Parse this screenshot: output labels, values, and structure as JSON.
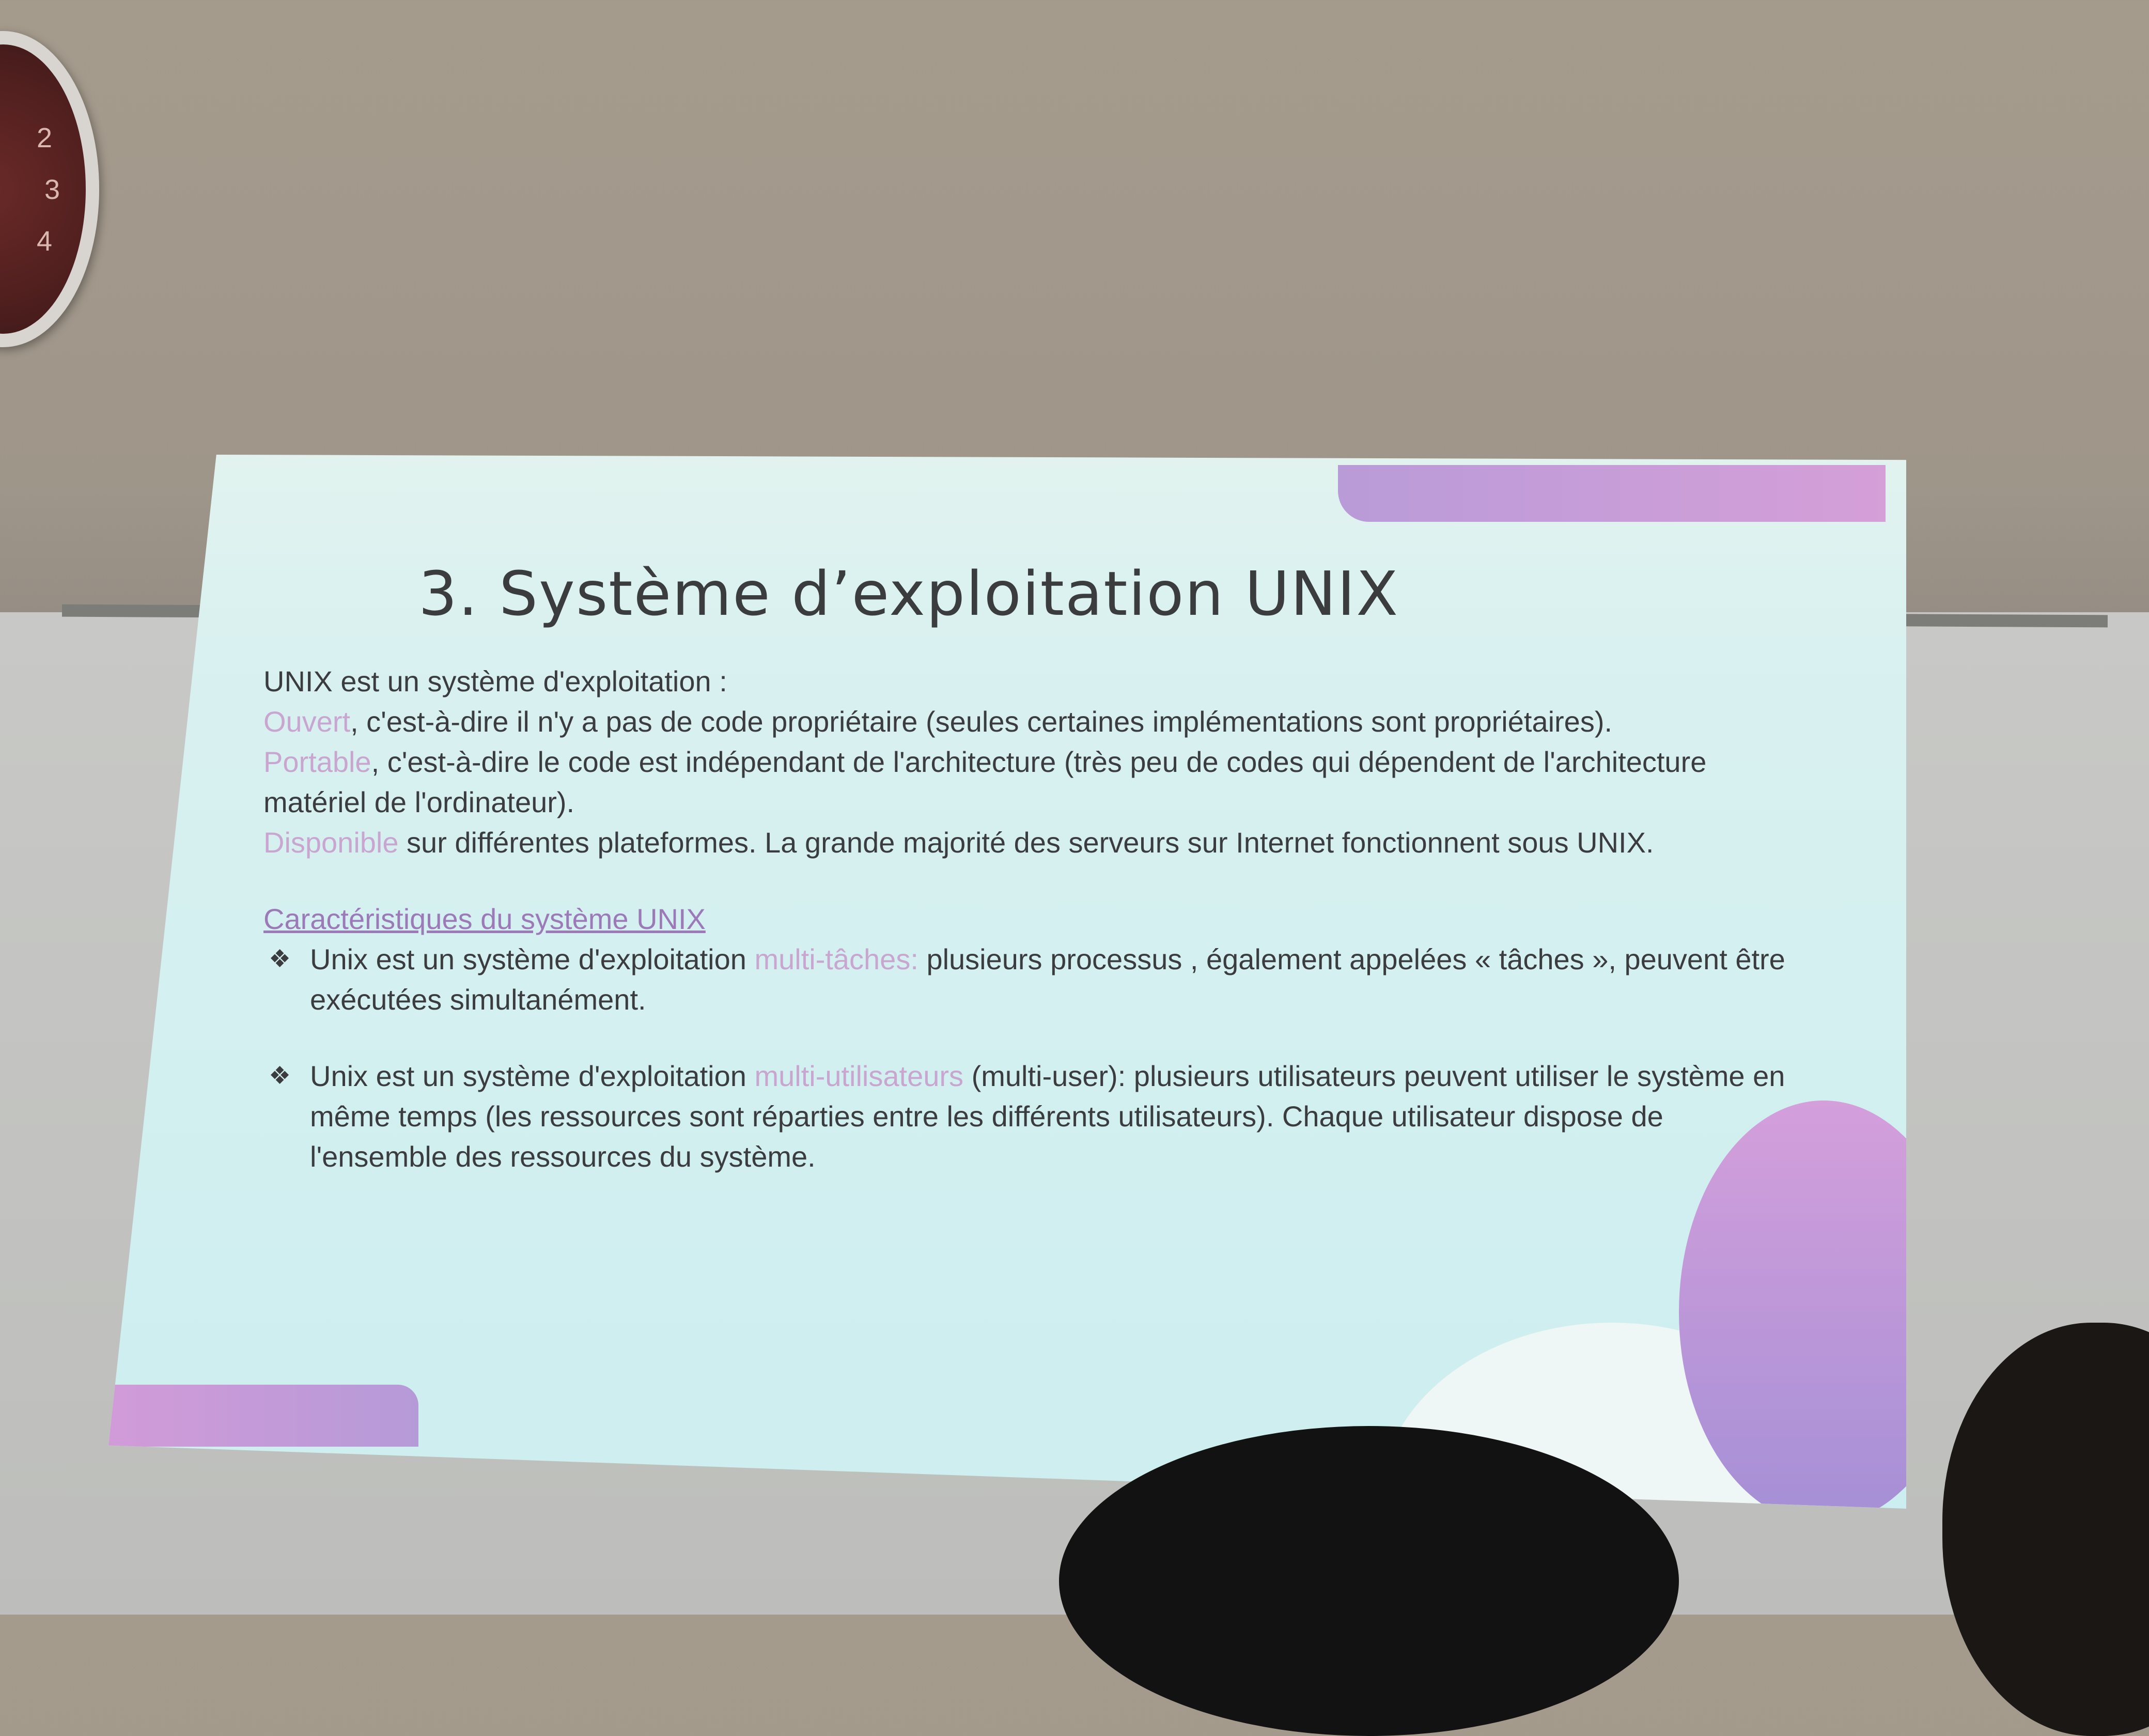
{
  "clock": {
    "numbers": [
      "2",
      "3",
      "4"
    ]
  },
  "slide": {
    "title": "3. Système d’exploitation UNIX",
    "intro": "UNIX est un système d'exploitation :",
    "items": [
      {
        "keyword": "Ouvert",
        "text": ", c'est-à-dire il n'y a pas de code propriétaire (seules certaines implémentations sont propriétaires)."
      },
      {
        "keyword": "Portable",
        "text": ", c'est-à-dire le code est indépendant de l'architecture (très peu de codes qui dépendent de l'architecture matériel de l'ordinateur)."
      },
      {
        "keyword": "Disponible",
        "text": " sur différentes plateformes. La grande majorité des serveurs sur Internet fonctionnent sous UNIX."
      }
    ],
    "section_title": "Caractéristiques du système UNIX",
    "bullets": [
      {
        "before": "Unix est un système d'exploitation ",
        "keyword": "multi-tâches:",
        "after": " plusieurs processus , également appelées « tâches », peuvent être exécutées simultanément."
      },
      {
        "before": "Unix est un système d'exploitation ",
        "keyword": "multi-utilisateurs",
        "after": " (multi-user): plusieurs utilisateurs peuvent utiliser le système en même temps (les ressources sont réparties entre les différents utilisateurs). Chaque utilisateur dispose de l'ensemble des ressources du système."
      }
    ],
    "bullet_icon": "diamond-bullet-icon"
  },
  "colors": {
    "accent_text": "#c9a6cf",
    "section_title": "#9c7ab8",
    "gradient_purple": "#b99bd8",
    "gradient_pink": "#d59fd8"
  }
}
